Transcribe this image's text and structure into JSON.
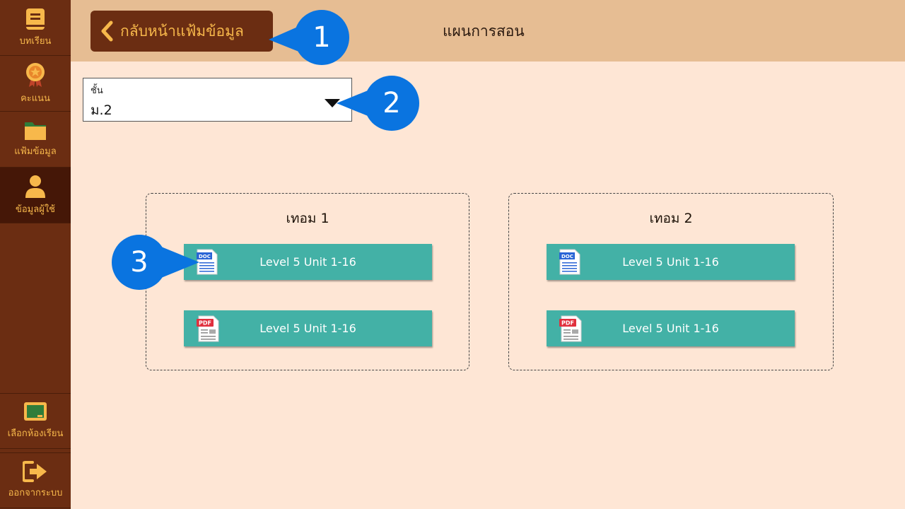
{
  "sidebar": {
    "items": [
      {
        "label": "บทเรียน",
        "icon": "book-icon"
      },
      {
        "label": "คะแนน",
        "icon": "medal-icon"
      },
      {
        "label": "แฟ้มข้อมูล",
        "icon": "folder-icon"
      },
      {
        "label": "ข้อมูลผู้ใช้",
        "icon": "user-icon",
        "active": true
      }
    ],
    "bottom_items": [
      {
        "label": "เลือกห้องเรียน",
        "icon": "classroom-board-icon"
      },
      {
        "label": "ออกจากระบบ",
        "icon": "logout-icon"
      }
    ]
  },
  "header": {
    "back_label": "กลับหน้าแฟ้มข้อมูล",
    "title": "แผนการสอน"
  },
  "grade_select": {
    "caption": "ชั้น",
    "value": "ม.2"
  },
  "terms": [
    {
      "title": "เทอม 1",
      "files": [
        {
          "type": "DOC",
          "label": "Level 5 Unit 1-16"
        },
        {
          "type": "PDF",
          "label": "Level 5 Unit 1-16"
        }
      ]
    },
    {
      "title": "เทอม 2",
      "files": [
        {
          "type": "DOC",
          "label": "Level 5 Unit 1-16"
        },
        {
          "type": "PDF",
          "label": "Level 5 Unit 1-16"
        }
      ]
    }
  ],
  "callouts": [
    "1",
    "2",
    "3"
  ],
  "colors": {
    "sidebar_bg": "#6b2d12",
    "sidebar_active": "#451707",
    "accent": "#f7b84b",
    "header_bg": "#e6bd93",
    "page_bg": "#fee6d5",
    "file_button": "#43b1a6",
    "callout": "#0a74e0"
  }
}
